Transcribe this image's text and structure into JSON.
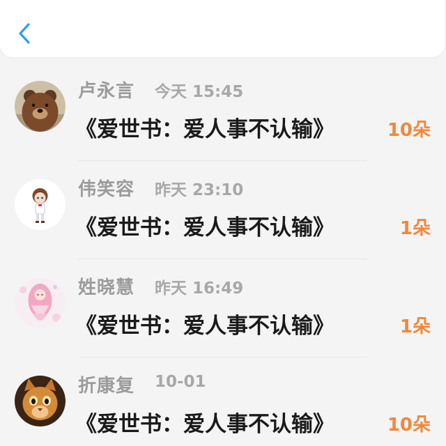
{
  "header": {
    "back_icon": "chevron-left-icon",
    "accent_color": "#2f9cf0"
  },
  "gifts": [
    {
      "name": "卢永言",
      "time": "今天 15:45",
      "title": "《爱世书：爱人事不认输》",
      "count": "10朵",
      "avatar": "bear-avatar"
    },
    {
      "name": "伟笑容",
      "time": "昨天 23:10",
      "title": "《爱世书：爱人事不认输》",
      "count": "1朵",
      "avatar": "chibi-boy-avatar"
    },
    {
      "name": "姓晓慧",
      "time": "昨天 16:49",
      "title": "《爱世书：爱人事不认输》",
      "count": "1朵",
      "avatar": "pink-girl-avatar"
    },
    {
      "name": "折康复",
      "time": "10-01",
      "title": "《爱世书：爱人事不认输》",
      "count": "10朵",
      "avatar": "cat-avatar"
    }
  ],
  "colors": {
    "count": "#f0883a",
    "name": "#9b9b9b",
    "title": "#1a1a1a"
  }
}
